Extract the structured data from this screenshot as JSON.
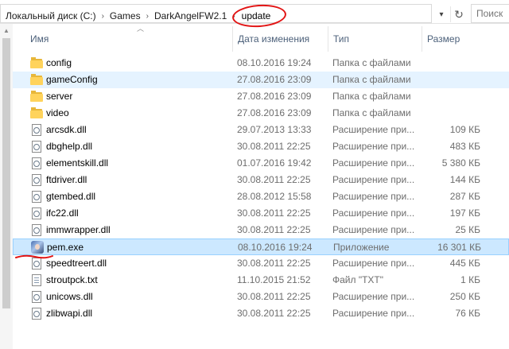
{
  "address": {
    "crumbs": [
      "Локальный диск (C:)",
      "Games",
      "DarkAngelFW2.1"
    ],
    "current": "update"
  },
  "search": {
    "placeholder": "Поиск"
  },
  "columns": {
    "name": "Имя",
    "date": "Дата изменения",
    "type": "Тип",
    "size": "Размер"
  },
  "files": [
    {
      "name": "config",
      "date": "08.10.2016 19:24",
      "type": "Папка с файлами",
      "size": "",
      "icon": "folder-icon"
    },
    {
      "name": "gameConfig",
      "date": "27.08.2016 23:09",
      "type": "Папка с файлами",
      "size": "",
      "icon": "folder-icon"
    },
    {
      "name": "server",
      "date": "27.08.2016 23:09",
      "type": "Папка с файлами",
      "size": "",
      "icon": "folder-icon"
    },
    {
      "name": "video",
      "date": "27.08.2016 23:09",
      "type": "Папка с файлами",
      "size": "",
      "icon": "folder-icon"
    },
    {
      "name": "arcsdk.dll",
      "date": "29.07.2013 13:33",
      "type": "Расширение при...",
      "size": "109 КБ",
      "icon": "dll-file-icon"
    },
    {
      "name": "dbghelp.dll",
      "date": "30.08.2011 22:25",
      "type": "Расширение при...",
      "size": "483 КБ",
      "icon": "dll-file-icon"
    },
    {
      "name": "elementskill.dll",
      "date": "01.07.2016 19:42",
      "type": "Расширение при...",
      "size": "5 380 КБ",
      "icon": "dll-file-icon"
    },
    {
      "name": "ftdriver.dll",
      "date": "30.08.2011 22:25",
      "type": "Расширение при...",
      "size": "144 КБ",
      "icon": "dll-file-icon"
    },
    {
      "name": "gtembed.dll",
      "date": "28.08.2012 15:58",
      "type": "Расширение при...",
      "size": "287 КБ",
      "icon": "dll-file-icon"
    },
    {
      "name": "ifc22.dll",
      "date": "30.08.2011 22:25",
      "type": "Расширение при...",
      "size": "197 КБ",
      "icon": "dll-file-icon"
    },
    {
      "name": "immwrapper.dll",
      "date": "30.08.2011 22:25",
      "type": "Расширение при...",
      "size": "25 КБ",
      "icon": "dll-file-icon"
    },
    {
      "name": "pem.exe",
      "date": "08.10.2016 19:24",
      "type": "Приложение",
      "size": "16 301 КБ",
      "icon": "exe-app-icon"
    },
    {
      "name": "speedtreert.dll",
      "date": "30.08.2011 22:25",
      "type": "Расширение при...",
      "size": "445 КБ",
      "icon": "dll-file-icon"
    },
    {
      "name": "stroutpck.txt",
      "date": "11.10.2015 21:52",
      "type": "Файл \"TXT\"",
      "size": "1 КБ",
      "icon": "txt-file-icon"
    },
    {
      "name": "unicows.dll",
      "date": "30.08.2011 22:25",
      "type": "Расширение при...",
      "size": "250 КБ",
      "icon": "dll-file-icon"
    },
    {
      "name": "zlibwapi.dll",
      "date": "30.08.2011 22:25",
      "type": "Расширение при...",
      "size": "76 КБ",
      "icon": "dll-file-icon"
    }
  ],
  "colors": {
    "selected": "#cce8ff",
    "hover": "#e5f3ff",
    "annotation": "#e21414",
    "folder": "#ffd35c"
  }
}
